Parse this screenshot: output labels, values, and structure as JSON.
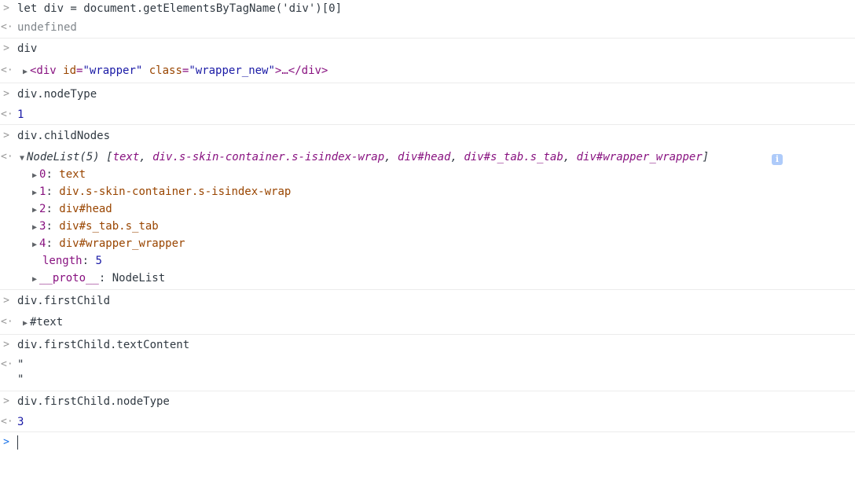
{
  "console": {
    "cmd1": {
      "prompt": ">",
      "code": "let div = document.getElementsByTagName('div')[0]",
      "result": "undefined"
    },
    "cmd2": {
      "code": "div",
      "result": {
        "open": "<div ",
        "id_attr": "id",
        "id_val": "\"wrapper\"",
        "class_attr": "class",
        "class_val": "\"wrapper_new\"",
        "ellipsis": ">…</div>"
      }
    },
    "cmd3": {
      "code": "div.nodeType",
      "result": "1"
    },
    "cmd4": {
      "code": "div.childNodes",
      "summary_head": "NodeList(5) [",
      "summary_items": [
        "text",
        "div.s-skin-container.s-isindex-wrap",
        "div#head",
        "div#s_tab.s_tab",
        "div#wrapper_wrapper"
      ],
      "summary_tail": "]",
      "info_glyph": "i",
      "children": [
        {
          "key": "0",
          "value": "text"
        },
        {
          "key": "1",
          "value": "div.s-skin-container.s-isindex-wrap"
        },
        {
          "key": "2",
          "value": "div#head"
        },
        {
          "key": "3",
          "value": "div#s_tab.s_tab"
        },
        {
          "key": "4",
          "value": "div#wrapper_wrapper"
        }
      ],
      "length_key": "length",
      "length_val": "5",
      "proto_key": "__proto__",
      "proto_val": "NodeList"
    },
    "cmd5": {
      "code": "div.firstChild",
      "result": "#text"
    },
    "cmd6": {
      "code": "div.firstChild.textContent",
      "result_line1": "\"",
      "result_line2": "\""
    },
    "cmd7": {
      "code": "div.firstChild.nodeType",
      "result": "3"
    },
    "input_prompt": ">",
    "result_marker": "<·",
    "colon": ": ",
    "comma": ", ",
    "expand_closed": "▶",
    "expand_open": "▼"
  }
}
